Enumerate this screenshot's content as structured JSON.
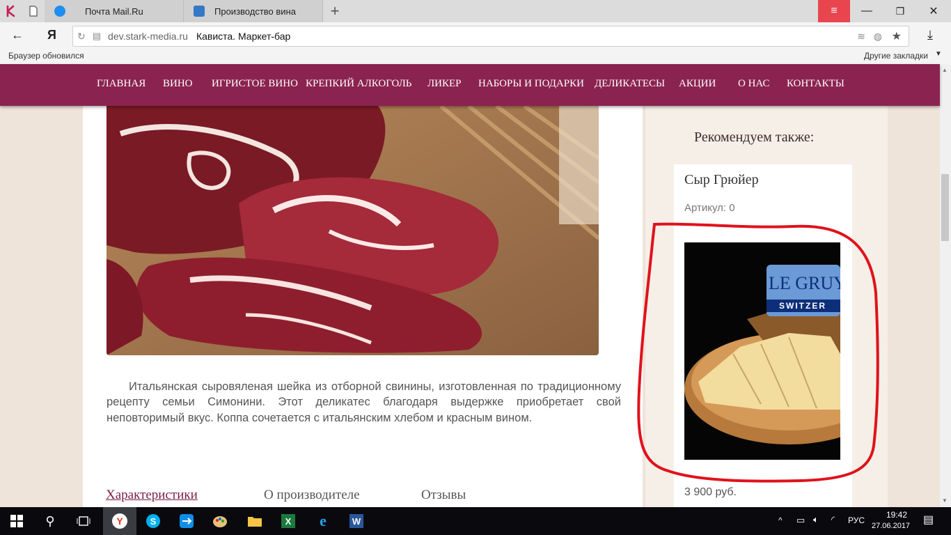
{
  "browser": {
    "tabs": [
      {
        "label": "Почта Mail.Ru"
      },
      {
        "label": "Производство вина"
      }
    ],
    "url_domain": "dev.stark-media.ru",
    "url_title": "Кависта. Маркет-бар",
    "bookmarks_left": "Браузер обновился",
    "bookmarks_right": "Другие закладки"
  },
  "nav": {
    "items": [
      "ГЛАВНАЯ",
      "ВИНО",
      "ИГРИСТОЕ ВИНО",
      "КРЕПКИЙ АЛКОГОЛЬ",
      "ЛИКЕР",
      "НАБОРЫ И ПОДАРКИ",
      "ДЕЛИКАТЕСЫ",
      "АКЦИИ",
      "О НАС",
      "КОНТАКТЫ"
    ]
  },
  "product": {
    "description": "Итальянская сыровяленая шейка из отборной свинины, изготовленная по традиционному рецепту семьи Симонини. Этот деликатес благодаря выдержке приобретает свой неповторимый вкус. Коппа сочетается с итальянским хлебом и красным вином."
  },
  "product_tabs": [
    "Характеристики",
    "О производителе",
    "Отзывы"
  ],
  "sidebar": {
    "heading": "Рекомендуем также:",
    "card": {
      "name": "Сыр Грюйер",
      "sku": "Артикул: 0",
      "price": "3 900 руб.",
      "image_label_top": "LE GRUY",
      "image_label_bottom": "SWITZER"
    }
  },
  "taskbar": {
    "language": "РУС",
    "time": "19:42",
    "date": "27.06.2017"
  },
  "colors": {
    "nav_bg": "#8b2350",
    "annotation": "#e0121c",
    "active_tab_link": "#7a1c44"
  }
}
